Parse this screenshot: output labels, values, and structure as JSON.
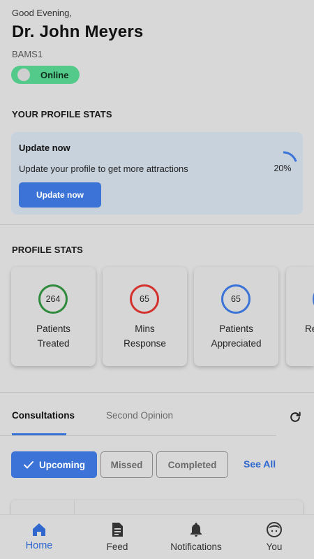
{
  "header": {
    "greeting": "Good Evening,",
    "doctor_name": "Dr. John Meyers",
    "degree": "BAMS1",
    "status_label": "Online"
  },
  "profile_update": {
    "section_title": "YOUR PROFILE STATS",
    "title": "Update now",
    "description": "Update your profile to get more attractions",
    "button_label": "Update now",
    "progress_text": "20%",
    "progress_value": 0.2
  },
  "profile_stats": {
    "section_title": "PROFILE STATS",
    "cards": [
      {
        "value": "264",
        "line1": "Patients",
        "line2": "Treated",
        "ring_color": "#2f8a3e"
      },
      {
        "value": "65",
        "line1": "Mins",
        "line2": "Response",
        "ring_color": "#d3322f"
      },
      {
        "value": "65",
        "line1": "Patients",
        "line2": "Appreciated",
        "ring_color": "#3b73d6"
      },
      {
        "value": "",
        "line1": "Re",
        "line2": "",
        "ring_color": "#3b73d6"
      }
    ]
  },
  "consultations": {
    "tabs": [
      {
        "label": "Consultations",
        "active": true
      },
      {
        "label": "Second Opinion",
        "active": false
      }
    ],
    "filters": [
      {
        "label": "Upcoming",
        "active": true
      },
      {
        "label": "Missed",
        "active": false
      },
      {
        "label": "Completed",
        "active": false
      }
    ],
    "see_all": "See All"
  },
  "bottom_nav": [
    {
      "label": "Home",
      "icon": "home-icon",
      "active": true
    },
    {
      "label": "Feed",
      "icon": "feed-icon",
      "active": false
    },
    {
      "label": "Notifications",
      "icon": "bell-icon",
      "active": false
    },
    {
      "label": "You",
      "icon": "face-icon",
      "active": false
    }
  ],
  "colors": {
    "accent": "#3b73d6",
    "online": "#53c98a",
    "background": "#d8d8d8",
    "card": "#c8d2dd"
  }
}
